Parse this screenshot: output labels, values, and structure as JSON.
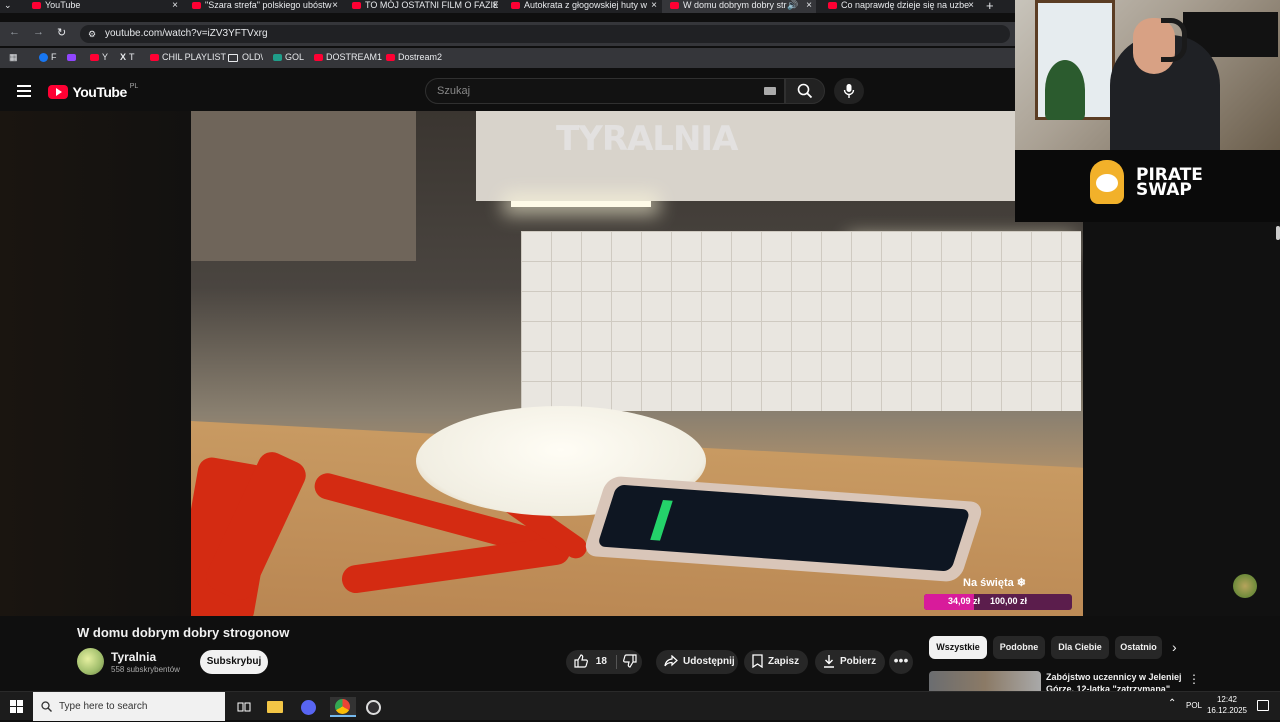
{
  "browser": {
    "tabs": [
      {
        "title": "YouTube"
      },
      {
        "title": "\"Szara strefa\" polskiego ubóstw"
      },
      {
        "title": "TO MÓJ OSTATNI FILM O FAZIE"
      },
      {
        "title": "Autokrata z głogowskiej huty w"
      },
      {
        "title": "W domu dobrym dobry str"
      },
      {
        "title": "Co naprawdę dzieje się na uzbe"
      }
    ],
    "url": "youtube.com/watch?v=iZV3YFTVxrg",
    "bookmarks": [
      {
        "label": "F"
      },
      {
        "label": ""
      },
      {
        "label": "Y"
      },
      {
        "label": "T"
      },
      {
        "label": "CHIL PLAYLIST"
      },
      {
        "label": "OLD\\"
      },
      {
        "label": "GOL"
      },
      {
        "label": "DOSTREAM1"
      },
      {
        "label": "Dostream2"
      }
    ]
  },
  "youtube": {
    "logo_text": "YouTube",
    "region": "PL",
    "search_placeholder": "Szukaj"
  },
  "video": {
    "watermark": "TYRALNIA",
    "donation": {
      "title": "Na święta ❄",
      "current": "34,09 zł",
      "goal": "100,00 zł",
      "progress": 0.34
    }
  },
  "overlay": {
    "brand_line1": "PIRATE",
    "brand_line2": "SWAP"
  },
  "details": {
    "title": "W domu dobrym dobry strogonow",
    "channel": "Tyralnia",
    "subscribers": "558 subskrybentów",
    "subscribe_label": "Subskrybuj",
    "likes": "18",
    "share_label": "Udostępnij",
    "save_label": "Zapisz",
    "download_label": "Pobierz"
  },
  "chips": [
    "Wszystkie",
    "Podobne",
    "Dla Ciebie",
    "Ostatnio"
  ],
  "recommendation": {
    "title": "Zabójstwo uczennicy w Jeleniej Górze. 12-latka \"zatrzymana\""
  },
  "taskbar": {
    "search_placeholder": "Type here to search",
    "language": "POL",
    "time": "12:42",
    "date": "16.12.2025"
  },
  "colors": {
    "youtube_red": "#ff0033",
    "donation_fill": "#d81b9b"
  }
}
